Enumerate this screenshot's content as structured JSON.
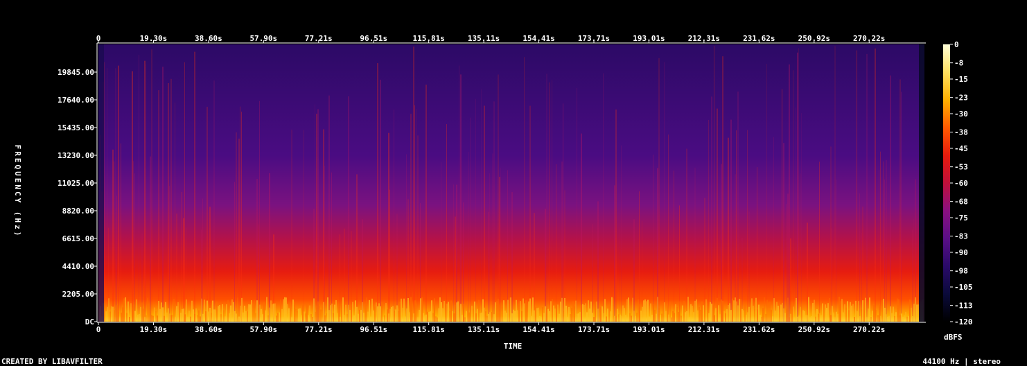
{
  "colors": {
    "background": "#000000",
    "text": "#ffffff",
    "colormap": [
      "#000000",
      "#0a0a3a",
      "#2a0a6a",
      "#5a0f86",
      "#8a1080",
      "#c0103a",
      "#e81b0c",
      "#ff5a00",
      "#ffb000",
      "#ffe060",
      "#ffffd8"
    ]
  },
  "footer": {
    "left": "CREATED BY LIBAVFILTER",
    "right": "44100 Hz | stereo"
  },
  "chart_data": {
    "type": "heatmap",
    "title": "",
    "xlabel": "TIME",
    "ylabel": "FREQUENCY (Hz)",
    "x_unit": "s",
    "y_unit": "Hz",
    "xlim": [
      0,
      289.6
    ],
    "ylim": [
      0,
      22050
    ],
    "x_ticks": [
      "0",
      "19.30s",
      "38.60s",
      "57.90s",
      "77.21s",
      "96.51s",
      "115.81s",
      "135.11s",
      "154.41s",
      "173.71s",
      "193.01s",
      "212.31s",
      "231.62s",
      "250.92s",
      "270.22s"
    ],
    "x_tick_values": [
      0,
      19.3,
      38.6,
      57.9,
      77.21,
      96.51,
      115.81,
      135.11,
      154.41,
      173.71,
      193.01,
      212.31,
      231.62,
      250.92,
      270.22
    ],
    "y_ticks": [
      "DC",
      "2205.00",
      "4410.00",
      "6615.00",
      "8820.00",
      "11025.00",
      "13230.00",
      "15435.00",
      "17640.00",
      "19845.00"
    ],
    "y_tick_values": [
      0,
      2205,
      4410,
      6615,
      8820,
      11025,
      13230,
      15435,
      17640,
      19845
    ],
    "colorbar": {
      "label": "dBFS",
      "range": [
        -120,
        0
      ],
      "ticks": [
        "0",
        "-8",
        "-15",
        "-23",
        "-30",
        "-38",
        "-45",
        "-53",
        "-60",
        "-68",
        "-75",
        "-83",
        "-90",
        "-98",
        "-105",
        "-113",
        "-120"
      ],
      "tick_values": [
        0,
        -8,
        -15,
        -23,
        -30,
        -38,
        -45,
        -53,
        -60,
        -68,
        -75,
        -83,
        -90,
        -98,
        -105,
        -113,
        -120
      ]
    },
    "channels": "stereo",
    "sample_rate_hz": 44100,
    "description_of_intensity": {
      "low_band_0_2205_hz_dbfs": -25,
      "mid_band_2205_6615_hz_dbfs": -50,
      "high_band_8820_22050_hz_dbfs": -90
    },
    "grid": false,
    "legend": "right"
  }
}
